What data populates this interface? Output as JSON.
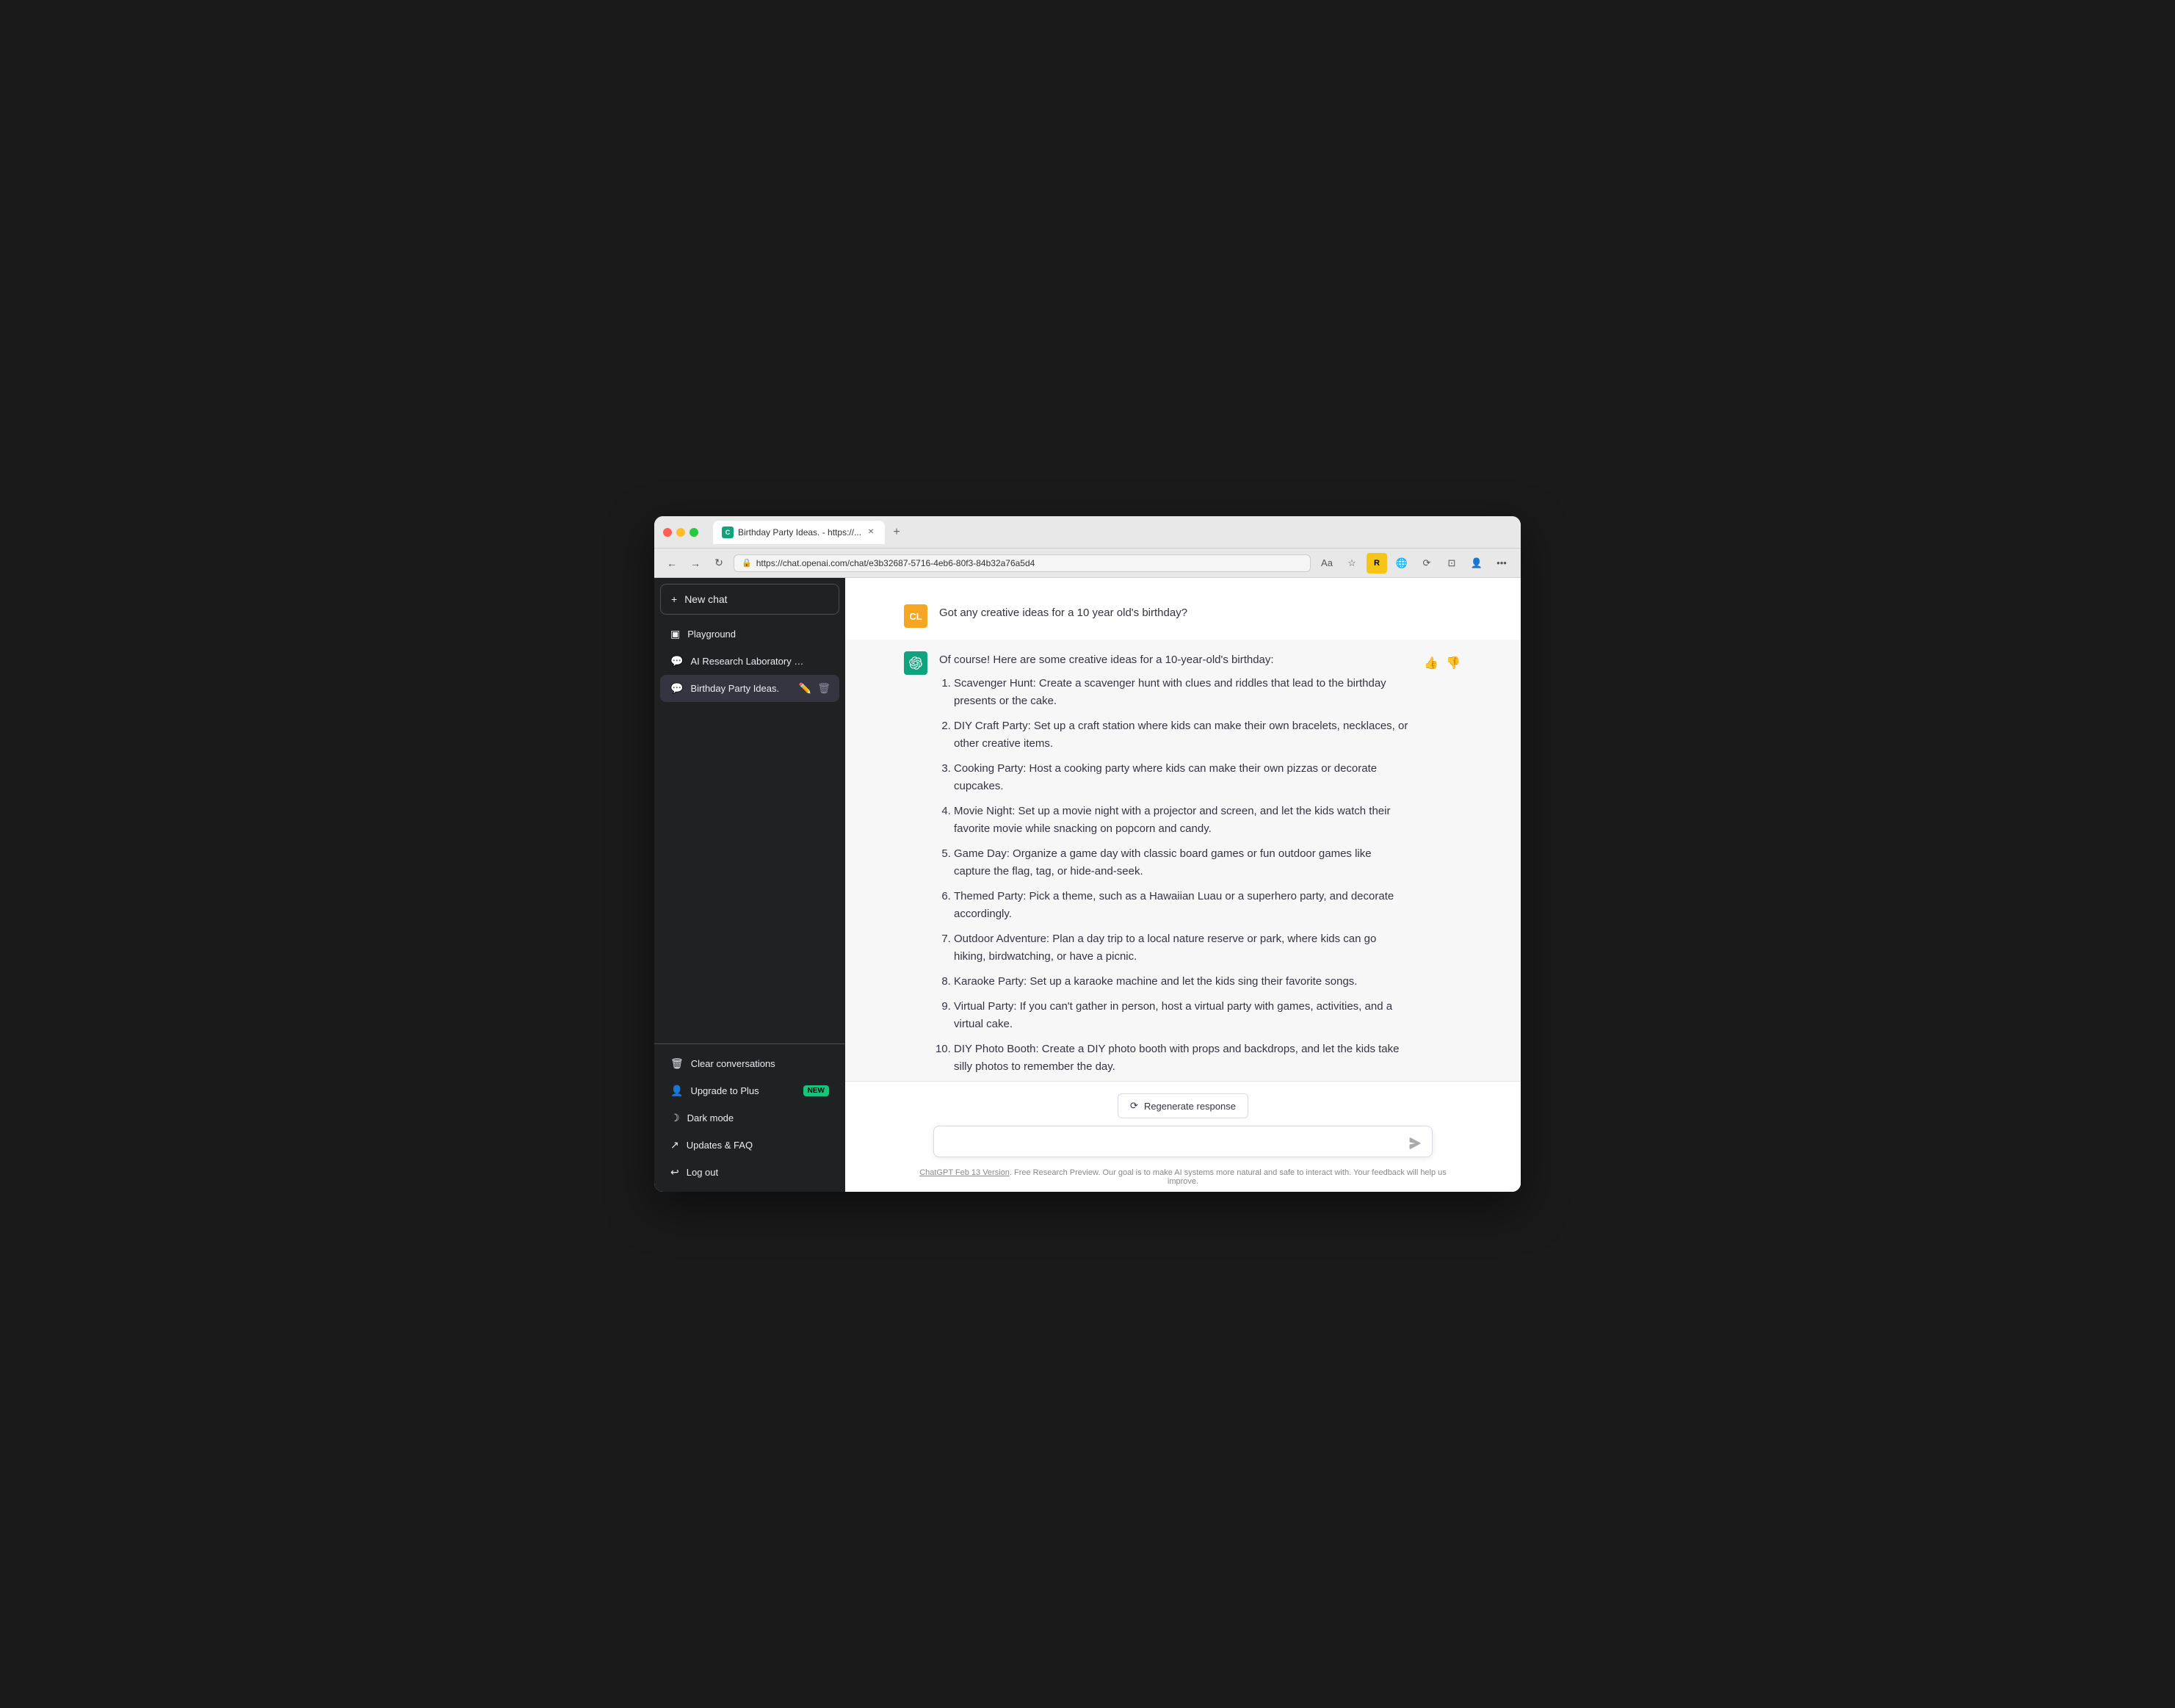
{
  "window": {
    "tab_title": "Birthday Party Ideas. - https://...",
    "url": "https://chat.openai.com/chat/e3b32687-5716-4eb6-80f3-84b32a76a5d4"
  },
  "sidebar": {
    "new_chat_label": "New chat",
    "playground_label": "Playground",
    "ai_research_label": "AI Research Laboratory Foun",
    "birthday_party_label": "Birthday Party Ideas.",
    "clear_conversations_label": "Clear conversations",
    "upgrade_label": "Upgrade to Plus",
    "upgrade_badge": "NEW",
    "dark_mode_label": "Dark mode",
    "updates_label": "Updates & FAQ",
    "logout_label": "Log out"
  },
  "messages": [
    {
      "role": "user",
      "avatar_text": "CL",
      "content": "Got any creative ideas for a 10 year old's birthday?"
    },
    {
      "role": "assistant",
      "avatar_text": "AI",
      "intro": "Of course! Here are some creative ideas for a 10-year-old's birthday:",
      "items": [
        "Scavenger Hunt: Create a scavenger hunt with clues and riddles that lead to the birthday presents or the cake.",
        "DIY Craft Party: Set up a craft station where kids can make their own bracelets, necklaces, or other creative items.",
        "Cooking Party: Host a cooking party where kids can make their own pizzas or decorate cupcakes.",
        "Movie Night: Set up a movie night with a projector and screen, and let the kids watch their favorite movie while snacking on popcorn and candy.",
        "Game Day: Organize a game day with classic board games or fun outdoor games like capture the flag, tag, or hide-and-seek.",
        "Themed Party: Pick a theme, such as a Hawaiian Luau or a superhero party, and decorate accordingly.",
        "Outdoor Adventure: Plan a day trip to a local nature reserve or park, where kids can go hiking, birdwatching, or have a picnic.",
        "Karaoke Party: Set up a karaoke machine and let the kids sing their favorite songs.",
        "Virtual Party: If you can't gather in person, host a virtual party with games, activities, and a virtual cake.",
        "DIY Photo Booth: Create a DIY photo booth with props and backdrops, and let the kids take silly photos to remember the day."
      ]
    }
  ],
  "input": {
    "placeholder": "",
    "regenerate_label": "Regenerate response"
  },
  "footer": {
    "link_text": "ChatGPT Feb 13 Version",
    "description": ". Free Research Preview. Our goal is to make AI systems more natural and safe to interact with. Your feedback will help us improve."
  }
}
